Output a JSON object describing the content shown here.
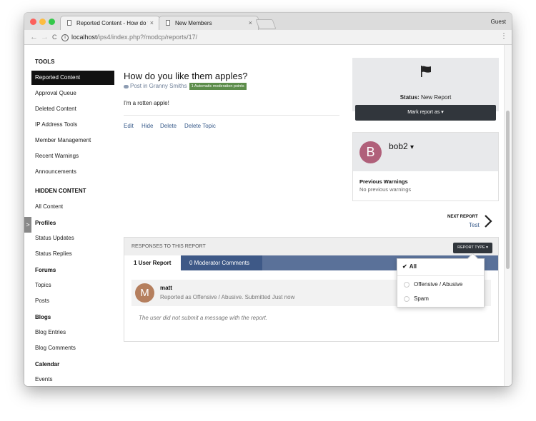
{
  "browser": {
    "tabs": [
      {
        "title": "Reported Content - How do yo",
        "close": "×"
      },
      {
        "title": "New Members",
        "close": "×"
      }
    ],
    "profile": "Guest",
    "nav": {
      "back": "←",
      "forward": "→",
      "reload": "C"
    },
    "url": {
      "host": "localhost",
      "path": "/ips4/index.php?/modcp/reports/17/"
    },
    "menu": "⋮"
  },
  "sidebar": {
    "sections": [
      {
        "heading": "TOOLS",
        "items": [
          "Reported Content",
          "Approval Queue",
          "Deleted Content",
          "IP Address Tools",
          "Member Management",
          "Recent Warnings",
          "Announcements"
        ]
      },
      {
        "heading": "HIDDEN CONTENT",
        "items": [
          "All Content"
        ]
      },
      {
        "heading": "Profiles",
        "items": [
          "Status Updates",
          "Status Replies"
        ]
      },
      {
        "heading": "Forums",
        "items": [
          "Topics",
          "Posts"
        ]
      },
      {
        "heading": "Blogs",
        "items": [
          "Blog Entries",
          "Blog Comments"
        ]
      },
      {
        "heading": "Calendar",
        "items": [
          "Events"
        ]
      }
    ],
    "toggle": ">"
  },
  "post": {
    "title": "How do you like them apples?",
    "meta": "Post in Granny Smiths",
    "badge": "1 Automatic moderation points",
    "body": "I'm a rotten apple!",
    "actions": [
      "Edit",
      "Hide",
      "Delete",
      "Delete Topic"
    ]
  },
  "status": {
    "label": "Status:",
    "value": "New Report",
    "mark_button": "Mark report as ▾"
  },
  "user": {
    "initial": "B",
    "name": "bob2",
    "caret": "▾",
    "warnings_title": "Previous Warnings",
    "warnings_value": "No previous warnings"
  },
  "next_report": {
    "label": "NEXT REPORT",
    "value": "Test"
  },
  "responses": {
    "title": "RESPONSES TO THIS REPORT",
    "report_type_button": "REPORT TYPE ▾",
    "tabs": [
      "1 User Report",
      "0 Moderator Comments"
    ],
    "report": {
      "initial": "M",
      "name": "matt",
      "description": "Reported as Offensive / Abusive. Submitted Just now",
      "message": "The user did not submit a message with the report."
    }
  },
  "report_type_menu": {
    "options": [
      "All",
      "Offensive / Abusive",
      "Spam"
    ],
    "selected": "All",
    "check": "✔"
  },
  "colors": {
    "accent_dark": "#31363c",
    "link": "#375a8a",
    "tab_bar": "#5a7199",
    "badge_green": "#5d8d4b",
    "avatar_b": "#b0607a",
    "avatar_m": "#b57f5e"
  }
}
